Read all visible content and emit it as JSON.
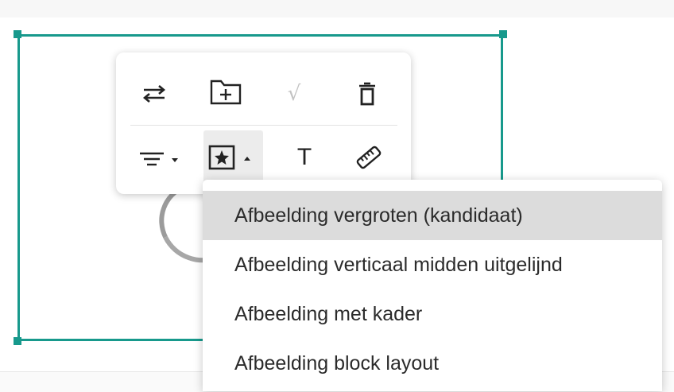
{
  "toolbar": {
    "row1": [
      {
        "name": "swap-icon"
      },
      {
        "name": "add-to-folder-icon"
      },
      {
        "name": "checkmark-icon",
        "text": "√",
        "disabled": true
      },
      {
        "name": "trash-icon"
      }
    ],
    "row2": [
      {
        "name": "filter-dropdown-icon"
      },
      {
        "name": "image-star-dropdown-icon",
        "active": true
      },
      {
        "name": "text-icon",
        "text": "T"
      },
      {
        "name": "ruler-icon"
      }
    ]
  },
  "menu": {
    "items": [
      {
        "label": "Afbeelding vergroten (kandidaat)",
        "highlighted": true
      },
      {
        "label": "Afbeelding verticaal midden uitgelijnd"
      },
      {
        "label": "Afbeelding met kader"
      },
      {
        "label": "Afbeelding block layout"
      }
    ]
  },
  "colors": {
    "selection": "#17998c",
    "menu_highlight": "#dcdcdc",
    "icon": "#222222",
    "disabled_icon": "#c3c3c3"
  }
}
